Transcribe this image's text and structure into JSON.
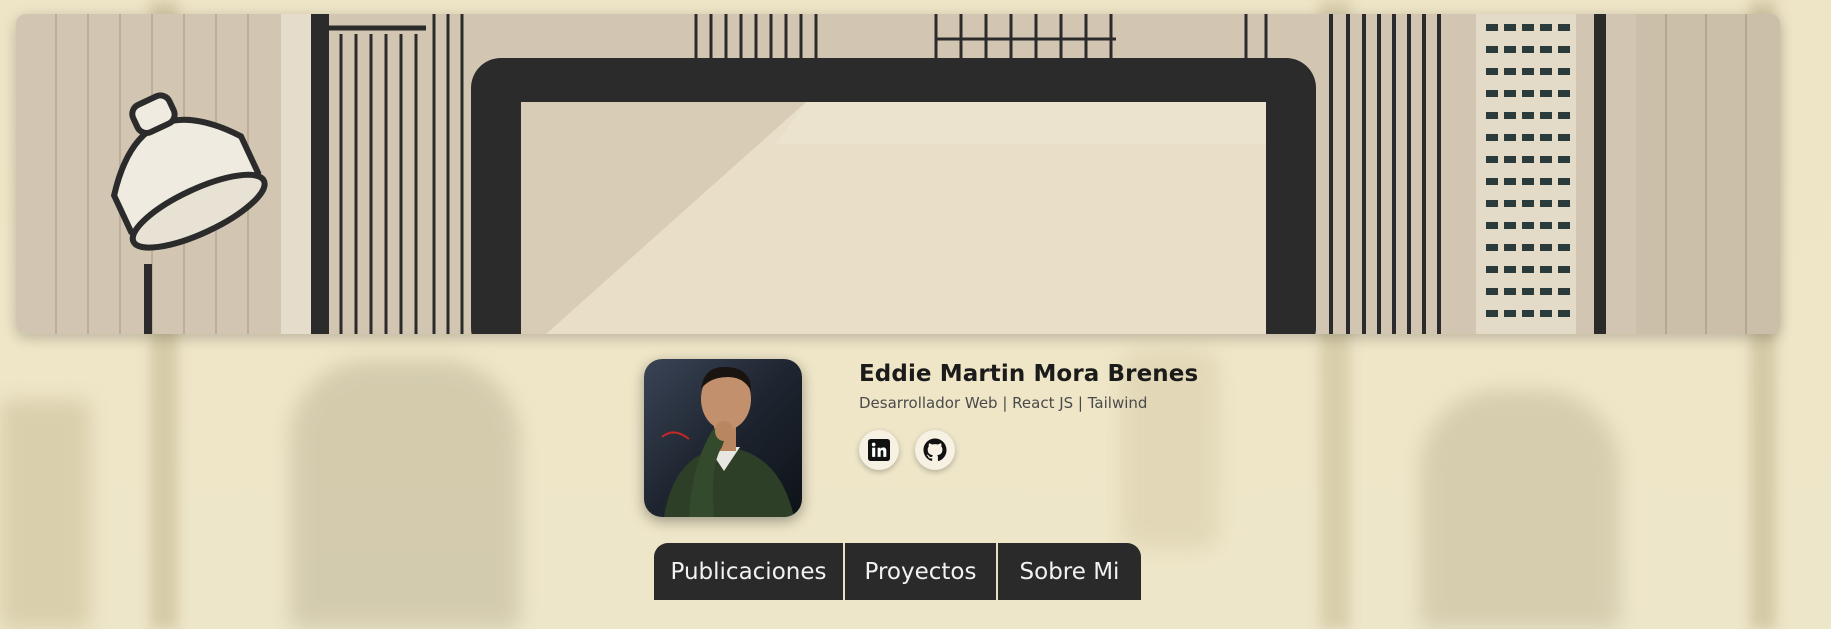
{
  "profile": {
    "name": "Eddie Martin Mora Brenes",
    "role": "Desarrollador Web | React JS | Tailwind",
    "avatar": "profile-photo",
    "socials": [
      {
        "name": "LinkedIn",
        "icon": "linkedin-icon"
      },
      {
        "name": "GitHub",
        "icon": "github-icon"
      }
    ]
  },
  "nav": {
    "tabs": [
      {
        "label": "Publicaciones"
      },
      {
        "label": "Proyectos"
      },
      {
        "label": "Sobre Mi"
      }
    ]
  },
  "theme": {
    "background": "#ece3c4",
    "tab_bg": "#2a2a2a",
    "tab_text": "#f2f2f2",
    "banner_line": "#2b2b2b",
    "banner_paper": "#e9dfc8"
  }
}
